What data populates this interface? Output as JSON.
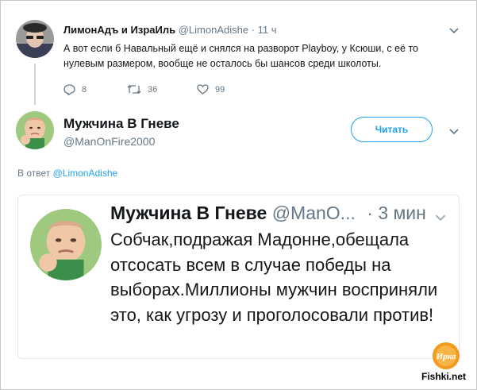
{
  "tweet1": {
    "author_name": "ЛимонАдъ и ИзраИль",
    "handle": "@LimonAdishe",
    "separator": "·",
    "time": "11 ч",
    "text": "А вот если б Навальный ещё и снялся на разворот Playboy, у Ксюши, с её то нулевым размером, вообще не осталось бы шансов среди школоты.",
    "reply_count": "8",
    "retweet_count": "36",
    "like_count": "99"
  },
  "tweet2": {
    "author_name": "Мужчина В Гневе",
    "handle": "@ManOnFire2000",
    "follow_label": "Читать",
    "reply_prefix": "В ответ",
    "reply_handle": "@LimonAdishe"
  },
  "card": {
    "author_name": "Мужчина В Гневе",
    "handle": "@ManO...",
    "separator": "·",
    "time": "3 мин",
    "text": "Собчак,подражая Мадонне,обещала отсосать всем в случае победы на выборах.Миллионы мужчин восприняли это, как угрозу и проголосовали против!"
  },
  "watermark": {
    "logo_text": "Ирка",
    "site": "Fishki.net"
  },
  "colors": {
    "accent": "#1da1f2",
    "muted": "#657786",
    "text": "#14171a",
    "border": "#e1e8ed"
  },
  "icons": [
    "chevron-down-icon",
    "reply-icon",
    "retweet-icon",
    "like-icon"
  ]
}
